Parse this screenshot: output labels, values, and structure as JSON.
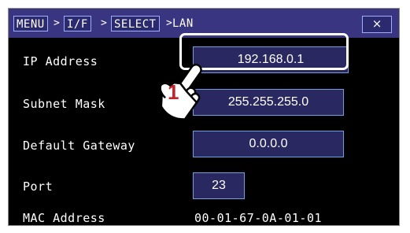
{
  "window": {
    "breadcrumb": {
      "menu": "MENU",
      "interface": "I/F",
      "select": "SELECT",
      "current": "LAN",
      "separator": ">"
    },
    "close_label": "×"
  },
  "fields": {
    "ip_address": {
      "label": "IP Address",
      "value": "192.168.0.1"
    },
    "subnet_mask": {
      "label": "Subnet Mask",
      "value": "255.255.255.0"
    },
    "default_gateway": {
      "label": "Default Gateway",
      "value": "0.0.0.0"
    },
    "port": {
      "label": "Port",
      "value": "23"
    },
    "mac_address": {
      "label": "MAC Address",
      "value": "00-01-67-0A-01-01"
    }
  },
  "callout": {
    "step_number": "1"
  },
  "colors": {
    "title_bar": "#3a3580",
    "field_bg": "#2a2860",
    "field_border": "#6fa0e0",
    "callout_number": "#c0242a"
  },
  "icons": {
    "pointer": "hand-pointer-icon",
    "close": "close-icon"
  }
}
